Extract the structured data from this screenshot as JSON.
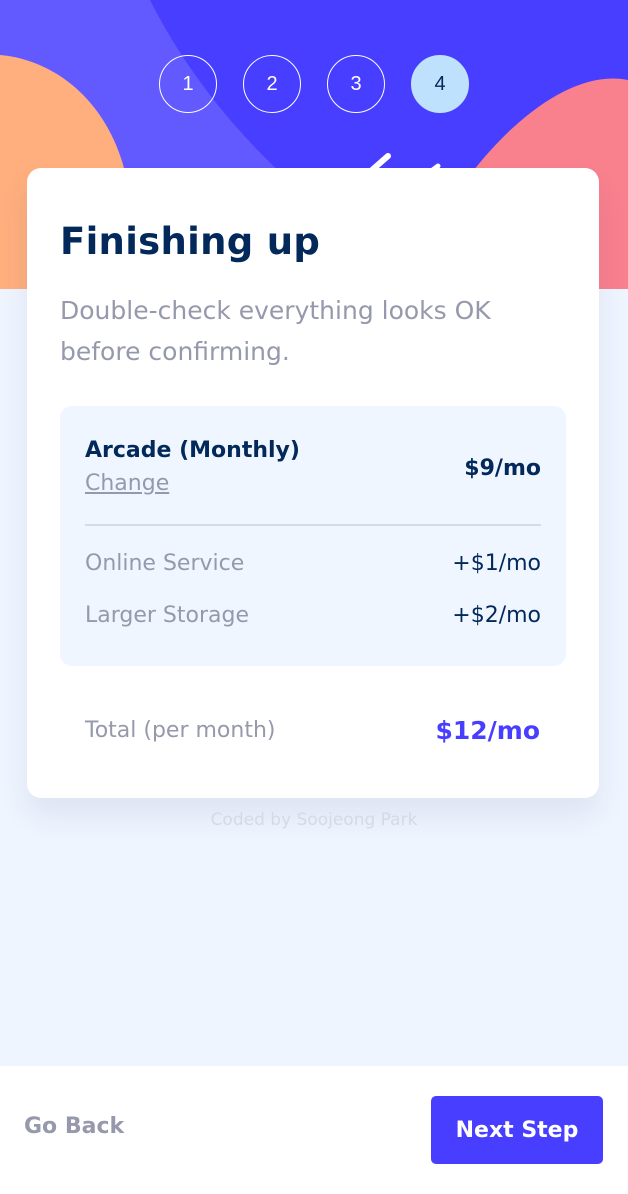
{
  "stepper": {
    "steps": [
      "1",
      "2",
      "3",
      "4"
    ],
    "active_step": "4"
  },
  "card": {
    "title": "Finishing up",
    "subtitle": "Double-check everything looks OK before confirming."
  },
  "summary": {
    "plan_name": "Arcade (Monthly)",
    "change_label": "Change",
    "plan_price": "$9/mo",
    "addons": [
      {
        "name": "Online Service",
        "price": "+$1/mo"
      },
      {
        "name": "Larger Storage",
        "price": "+$2/mo"
      }
    ]
  },
  "total": {
    "label": "Total (per month)",
    "price": "$12/mo"
  },
  "attribution": "Coded by Soojeong Park",
  "footer": {
    "back_label": "Go Back",
    "next_label": "Next Step"
  },
  "colors": {
    "accent": "#483eff",
    "marine_blue": "#02295a",
    "cool_gray": "#9699ab",
    "background": "#eff5ff",
    "active_step": "#bee2fd",
    "blob_orange": "#ffaf7e",
    "blob_pink": "#f9818e",
    "blob_violet": "#6259ff"
  }
}
